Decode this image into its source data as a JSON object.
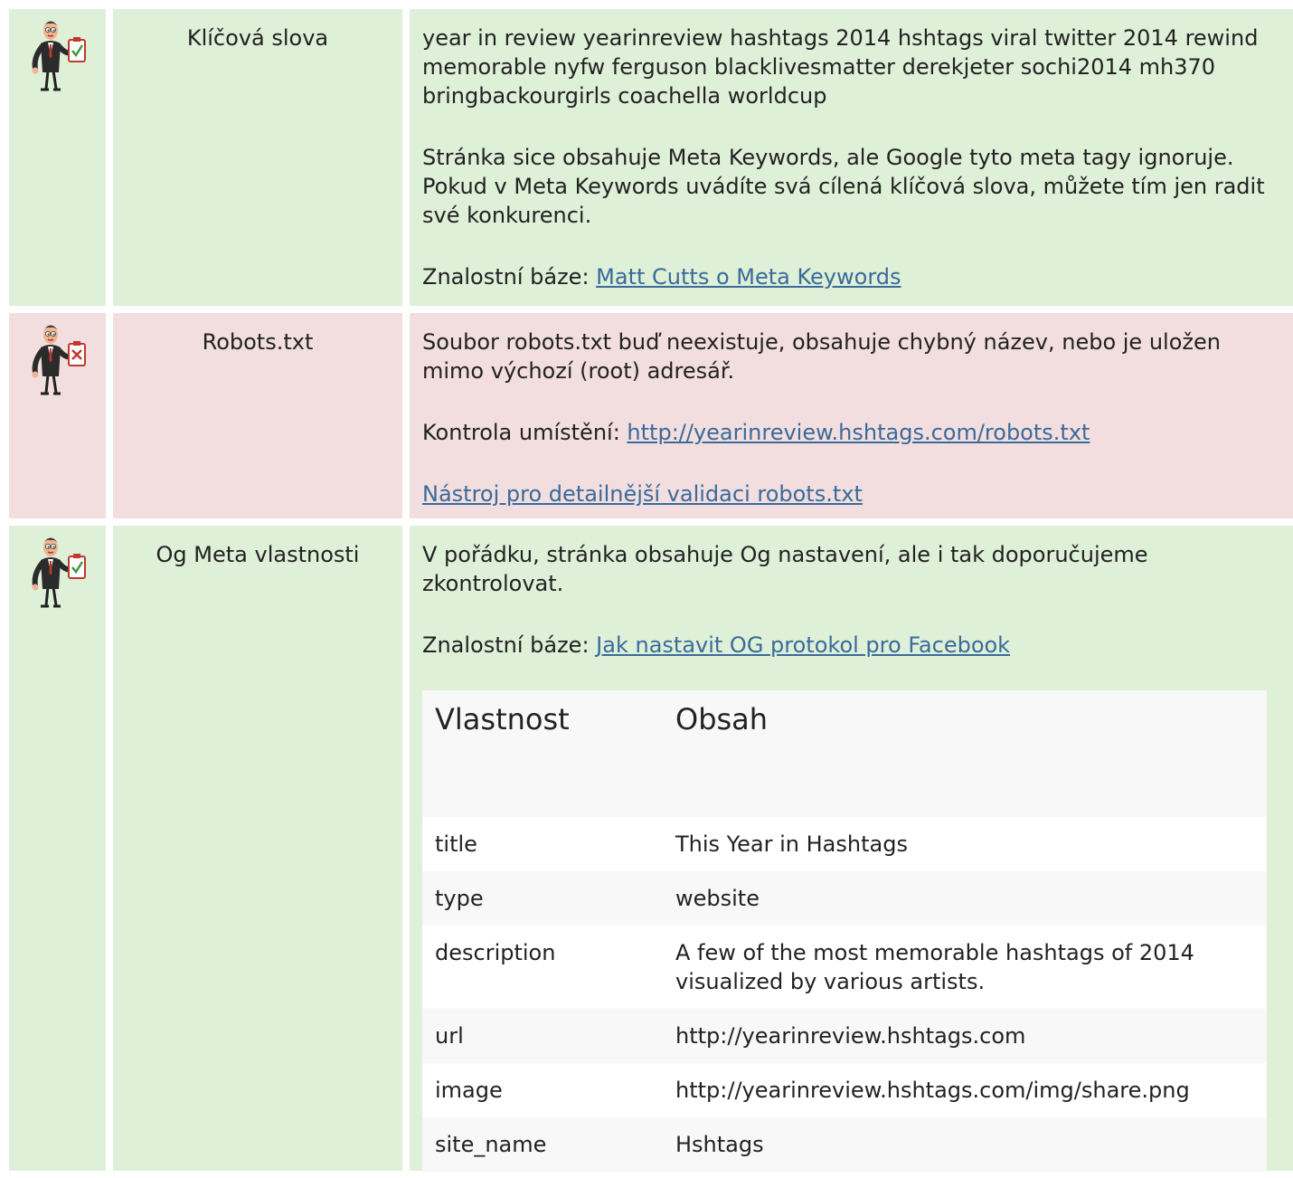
{
  "rows": [
    {
      "status": "ok",
      "icon": "businessman-checklist-ok-icon",
      "name": "Klíčová slova",
      "keywords": "year in review yearinreview hashtags 2014 hshtags viral twitter 2014 rewind memorable nyfw ferguson blacklivesmatter derekjeter sochi2014 mh370 bringbackourgirls coachella worldcup",
      "note": "Stránka sice obsahuje Meta Keywords, ale Google tyto meta tagy ignoruje. Pokud v Meta Keywords uvádíte svá cílená klíčová slova, můžete tím jen radit své konkurenci.",
      "kb_prefix": "Znalostní báze:",
      "kb_link": "Matt Cutts o Meta Keywords"
    },
    {
      "status": "bad",
      "icon": "businessman-checklist-error-icon",
      "name": "Robots.txt",
      "message": "Soubor robots.txt buď neexistuje, obsahuje chybný název, nebo je uložen mimo výchozí (root) adresář.",
      "check_prefix": "Kontrola umístění:",
      "check_link": "http://yearinreview.hshtags.com/robots.txt",
      "tool_link": "Nástroj pro detailnější validaci robots.txt"
    },
    {
      "status": "ok",
      "icon": "businessman-checklist-ok-icon",
      "name": "Og Meta vlastnosti",
      "message": "V pořádku, stránka obsahuje Og nastavení, ale i tak doporučujeme zkontrolovat.",
      "kb_prefix": "Znalostní báze:",
      "kb_link": "Jak nastavit OG protokol pro Facebook",
      "table": {
        "col_property": "Vlastnost",
        "col_content": "Obsah",
        "rows": [
          {
            "property": "title",
            "content": "This Year in Hashtags"
          },
          {
            "property": "type",
            "content": "website"
          },
          {
            "property": "description",
            "content": "A few of the most memorable hashtags of 2014 visualized by various artists."
          },
          {
            "property": "url",
            "content": "http://yearinreview.hshtags.com"
          },
          {
            "property": "image",
            "content": "http://yearinreview.hshtags.com/img/share.png"
          },
          {
            "property": "site_name",
            "content": "Hshtags"
          }
        ]
      }
    }
  ],
  "colors": {
    "ok_bg": "#dff0d8",
    "bad_bg": "#f2dede",
    "link": "#3a6a9a"
  }
}
